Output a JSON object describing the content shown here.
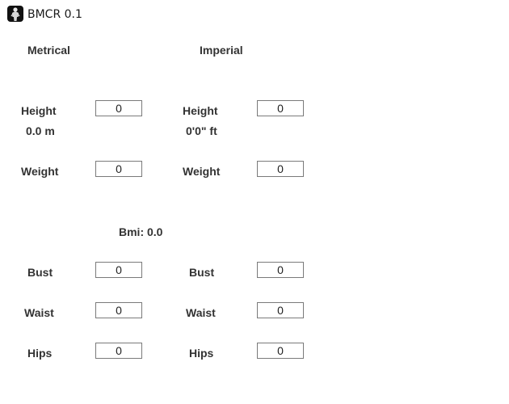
{
  "window": {
    "title": "BMCR 0.1",
    "icon": "app-logo-icon"
  },
  "metric": {
    "header": "Metrical",
    "height_label": "Height",
    "height_value": "0",
    "height_display": "0.0 m",
    "weight_label": "Weight",
    "weight_value": "0"
  },
  "imperial": {
    "header": "Imperial",
    "height_label": "Height",
    "height_value": "0",
    "height_display": "0'0\" ft",
    "weight_label": "Weight",
    "weight_value": "0"
  },
  "bmi": {
    "text": "Bmi: 0.0"
  },
  "metric_measures": {
    "bust_label": "Bust",
    "bust_value": "0",
    "waist_label": "Waist",
    "waist_value": "0",
    "hips_label": "Hips",
    "hips_value": "0"
  },
  "imperial_measures": {
    "bust_label": "Bust",
    "bust_value": "0",
    "waist_label": "Waist",
    "waist_value": "0",
    "hips_label": "Hips",
    "hips_value": "0"
  }
}
